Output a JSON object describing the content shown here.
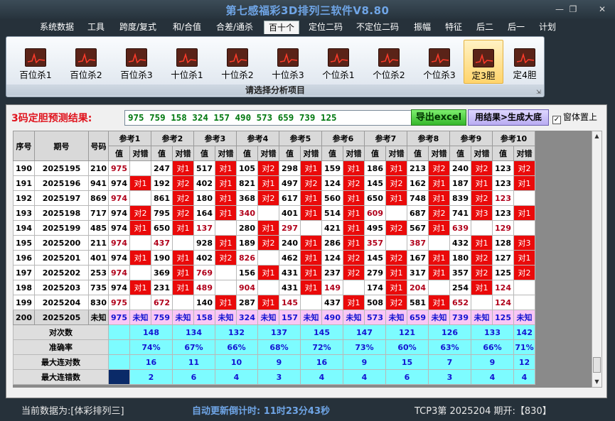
{
  "window": {
    "title": "第七感福彩3D排列三软件V8.80",
    "min": "—",
    "max": "❐",
    "close": "✕"
  },
  "menu": [
    {
      "label": "系统数据",
      "active": false
    },
    {
      "label": "工具",
      "active": false
    },
    {
      "label": "跨度/复式",
      "active": false
    },
    {
      "label": "和/合值",
      "active": false
    },
    {
      "label": "合差/通杀",
      "active": false
    },
    {
      "label": "百十个",
      "active": true
    },
    {
      "label": "定位二码",
      "active": false
    },
    {
      "label": "不定位二码",
      "active": false
    },
    {
      "label": "振幅",
      "active": false
    },
    {
      "label": "特征",
      "active": false
    },
    {
      "label": "后二",
      "active": false
    },
    {
      "label": "后一",
      "active": false
    },
    {
      "label": "计划",
      "active": false
    }
  ],
  "ribbon": {
    "items": [
      {
        "label": "百位杀1",
        "icon": "chart-icon",
        "selected": false
      },
      {
        "label": "百位杀2",
        "icon": "chart-icon",
        "selected": false
      },
      {
        "label": "百位杀3",
        "icon": "chart-icon",
        "selected": false
      },
      {
        "label": "十位杀1",
        "icon": "chart-icon",
        "selected": false
      },
      {
        "label": "十位杀2",
        "icon": "chart-icon",
        "selected": false
      },
      {
        "label": "十位杀3",
        "icon": "chart-icon",
        "selected": false
      },
      {
        "label": "个位杀1",
        "icon": "chart-icon",
        "selected": false
      },
      {
        "label": "个位杀2",
        "icon": "chart-icon",
        "selected": false
      },
      {
        "label": "个位杀3",
        "icon": "chart-icon",
        "selected": false
      },
      {
        "label": "定3胆",
        "icon": "chart-icon",
        "selected": true
      },
      {
        "label": "定4胆",
        "icon": "chart-icon",
        "selected": false
      }
    ],
    "caption": "请选择分析项目"
  },
  "result": {
    "label": "3码定胆预测结果:",
    "value": "975 759 158 324 157 490 573 659 739 125",
    "excel_button": "导出excel",
    "gen_button": "用结果>生成大底",
    "ontop_label": "窗体置上",
    "ontop_checked": "✓"
  },
  "table": {
    "col_headers": [
      "序号",
      "期号",
      "号码"
    ],
    "ref_headers": [
      "参考1",
      "参考2",
      "参考3",
      "参考4",
      "参考5",
      "参考6",
      "参考7",
      "参考8",
      "参考9",
      "参考10"
    ],
    "sub_headers": [
      "值",
      "对错"
    ],
    "rows": [
      {
        "seq": "190",
        "issue": "2025195",
        "num": "210",
        "cells": [
          [
            "975",
            ""
          ],
          [
            "247",
            "对1"
          ],
          [
            "517",
            "对1"
          ],
          [
            "105",
            "对2"
          ],
          [
            "298",
            "对1"
          ],
          [
            "159",
            "对1"
          ],
          [
            "186",
            "对1"
          ],
          [
            "213",
            "对2"
          ],
          [
            "240",
            "对2"
          ],
          [
            "123",
            "对2"
          ]
        ]
      },
      {
        "seq": "191",
        "issue": "2025196",
        "num": "941",
        "cells": [
          [
            "974",
            "对1"
          ],
          [
            "192",
            "对2"
          ],
          [
            "402",
            "对1"
          ],
          [
            "821",
            "对1"
          ],
          [
            "497",
            "对2"
          ],
          [
            "124",
            "对2"
          ],
          [
            "145",
            "对2"
          ],
          [
            "162",
            "对1"
          ],
          [
            "187",
            "对1"
          ],
          [
            "123",
            "对1"
          ]
        ]
      },
      {
        "seq": "192",
        "issue": "2025197",
        "num": "869",
        "cells": [
          [
            "974",
            ""
          ],
          [
            "861",
            "对2"
          ],
          [
            "180",
            "对1"
          ],
          [
            "368",
            "对2"
          ],
          [
            "617",
            "对1"
          ],
          [
            "560",
            "对1"
          ],
          [
            "650",
            "对1"
          ],
          [
            "748",
            "对1"
          ],
          [
            "839",
            "对2"
          ],
          [
            "123",
            ""
          ]
        ]
      },
      {
        "seq": "193",
        "issue": "2025198",
        "num": "717",
        "cells": [
          [
            "974",
            "对2"
          ],
          [
            "795",
            "对2"
          ],
          [
            "164",
            "对1"
          ],
          [
            "340",
            ""
          ],
          [
            "401",
            "对1"
          ],
          [
            "514",
            "对1"
          ],
          [
            "609",
            ""
          ],
          [
            "687",
            "对2"
          ],
          [
            "741",
            "对3"
          ],
          [
            "123",
            "对1"
          ]
        ]
      },
      {
        "seq": "194",
        "issue": "2025199",
        "num": "485",
        "cells": [
          [
            "974",
            "对1"
          ],
          [
            "650",
            "对1"
          ],
          [
            "137",
            ""
          ],
          [
            "280",
            "对1"
          ],
          [
            "297",
            ""
          ],
          [
            "421",
            "对1"
          ],
          [
            "495",
            "对2"
          ],
          [
            "567",
            "对1"
          ],
          [
            "639",
            ""
          ],
          [
            "129",
            ""
          ]
        ]
      },
      {
        "seq": "195",
        "issue": "2025200",
        "num": "211",
        "cells": [
          [
            "974",
            ""
          ],
          [
            "437",
            ""
          ],
          [
            "928",
            "对1"
          ],
          [
            "189",
            "对2"
          ],
          [
            "240",
            "对1"
          ],
          [
            "286",
            "对1"
          ],
          [
            "357",
            ""
          ],
          [
            "387",
            ""
          ],
          [
            "432",
            "对1"
          ],
          [
            "128",
            "对3"
          ]
        ]
      },
      {
        "seq": "196",
        "issue": "2025201",
        "num": "401",
        "cells": [
          [
            "974",
            "对1"
          ],
          [
            "190",
            "对1"
          ],
          [
            "402",
            "对2"
          ],
          [
            "826",
            ""
          ],
          [
            "462",
            "对1"
          ],
          [
            "124",
            "对2"
          ],
          [
            "145",
            "对2"
          ],
          [
            "167",
            "对1"
          ],
          [
            "180",
            "对2"
          ],
          [
            "127",
            "对1"
          ]
        ]
      },
      {
        "seq": "197",
        "issue": "2025202",
        "num": "253",
        "cells": [
          [
            "974",
            ""
          ],
          [
            "369",
            "对1"
          ],
          [
            "769",
            ""
          ],
          [
            "156",
            "对1"
          ],
          [
            "431",
            "对1"
          ],
          [
            "237",
            "对2"
          ],
          [
            "279",
            "对1"
          ],
          [
            "317",
            "对1"
          ],
          [
            "357",
            "对2"
          ],
          [
            "125",
            "对2"
          ]
        ]
      },
      {
        "seq": "198",
        "issue": "2025203",
        "num": "735",
        "cells": [
          [
            "974",
            "对1"
          ],
          [
            "231",
            "对1"
          ],
          [
            "489",
            ""
          ],
          [
            "904",
            ""
          ],
          [
            "431",
            "对1"
          ],
          [
            "149",
            ""
          ],
          [
            "174",
            "对1"
          ],
          [
            "204",
            ""
          ],
          [
            "254",
            "对1"
          ],
          [
            "124",
            ""
          ]
        ]
      },
      {
        "seq": "199",
        "issue": "2025204",
        "num": "830",
        "cells": [
          [
            "975",
            ""
          ],
          [
            "672",
            ""
          ],
          [
            "140",
            "对1"
          ],
          [
            "287",
            "对1"
          ],
          [
            "145",
            ""
          ],
          [
            "437",
            "对1"
          ],
          [
            "508",
            "对2"
          ],
          [
            "581",
            "对1"
          ],
          [
            "652",
            ""
          ],
          [
            "124",
            ""
          ]
        ]
      }
    ],
    "pred_row": {
      "seq": "200",
      "issue": "2025205",
      "num": "未知",
      "cells": [
        [
          "975",
          "未知"
        ],
        [
          "759",
          "未知"
        ],
        [
          "158",
          "未知"
        ],
        [
          "324",
          "未知"
        ],
        [
          "157",
          "未知"
        ],
        [
          "490",
          "未知"
        ],
        [
          "573",
          "未知"
        ],
        [
          "659",
          "未知"
        ],
        [
          "739",
          "未知"
        ],
        [
          "125",
          "未知"
        ]
      ]
    },
    "stats": [
      {
        "label": "对次数",
        "values": [
          "148",
          "134",
          "132",
          "137",
          "145",
          "147",
          "121",
          "126",
          "133",
          "142"
        ]
      },
      {
        "label": "准确率",
        "values": [
          "74%",
          "67%",
          "66%",
          "68%",
          "72%",
          "73%",
          "60%",
          "63%",
          "66%",
          "71%"
        ]
      },
      {
        "label": "最大连对数",
        "values": [
          "16",
          "11",
          "10",
          "9",
          "16",
          "9",
          "15",
          "7",
          "9",
          "12"
        ]
      },
      {
        "label": "最大连错数",
        "values": [
          "2",
          "6",
          "4",
          "3",
          "4",
          "4",
          "6",
          "3",
          "4",
          "4"
        ]
      }
    ]
  },
  "status": {
    "source": "当前数据为:[体彩排列三]",
    "countdown": "自动更新倒计时:  11时23分43秒",
    "info": "TCP3第 2025204 期开:【830】"
  },
  "colors": {
    "hit_cell": "#ea0a0a",
    "prediction_row": "#f9c7f5",
    "stats_rows": "#7dfcff",
    "title": "#6fa5e6",
    "result_label": "#e0141e",
    "result_text": "#00780f"
  }
}
